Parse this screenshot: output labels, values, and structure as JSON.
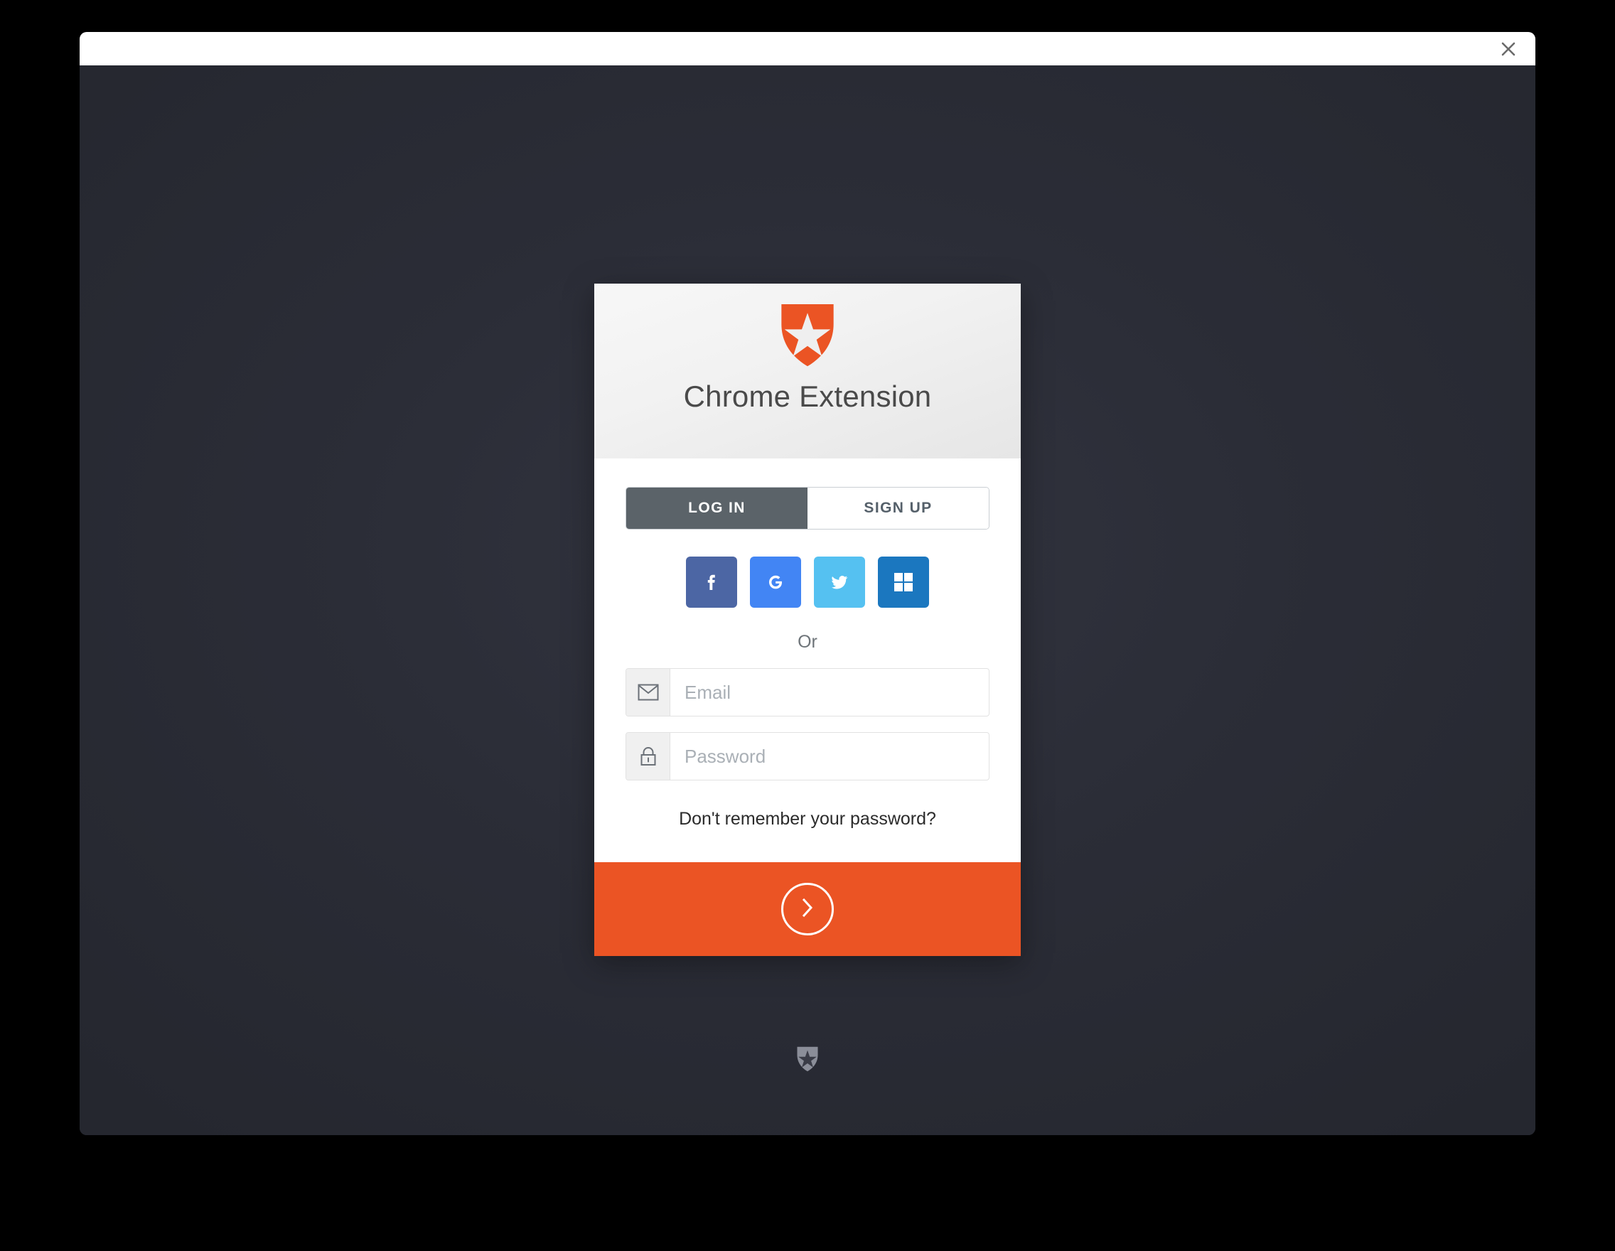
{
  "window": {
    "title_bar": {
      "close_label": "×",
      "close_icon": "close-icon"
    }
  },
  "card": {
    "logo_icon": "auth0-shield-logo",
    "title": "Chrome Extension",
    "tabs": [
      {
        "label": "LOG IN",
        "active": true
      },
      {
        "label": "SIGN UP",
        "active": false
      }
    ],
    "social_buttons": [
      {
        "name": "facebook",
        "icon": "facebook-icon",
        "color": "#4c66a4"
      },
      {
        "name": "google",
        "icon": "google-icon",
        "color": "#4285f4"
      },
      {
        "name": "twitter",
        "icon": "twitter-icon",
        "color": "#55c1f1"
      },
      {
        "name": "microsoft",
        "icon": "windows-icon",
        "color": "#1b77bf"
      }
    ],
    "divider_text": "Or",
    "fields": [
      {
        "name": "email",
        "icon": "envelope-icon",
        "placeholder": "Email",
        "value": ""
      },
      {
        "name": "password",
        "icon": "lock-icon",
        "placeholder": "Password",
        "value": ""
      }
    ],
    "forgot_password_label": "Don't remember your password?",
    "submit": {
      "icon": "chevron-right-icon",
      "color": "#eb5424"
    }
  },
  "badge": {
    "icon": "auth0-badge-icon"
  },
  "colors": {
    "accent": "#eb5424",
    "tab_active_bg": "#5b6369",
    "backdrop": "#2d2f3a",
    "card_bg": "#ffffff",
    "input_icon_bg": "#f0f0f0"
  }
}
